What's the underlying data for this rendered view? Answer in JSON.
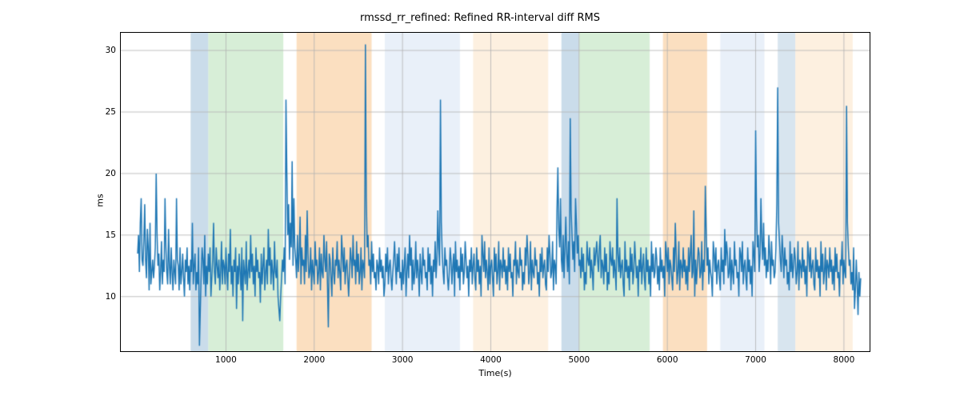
{
  "chart_data": {
    "type": "line",
    "title": "rmssd_rr_refined: Refined RR-interval diff RMS",
    "xlabel": "Time(s)",
    "ylabel": "ms",
    "xlim": [
      -200,
      8300
    ],
    "ylim": [
      5.5,
      31.5
    ],
    "xticks": [
      1000,
      2000,
      3000,
      4000,
      5000,
      6000,
      7000,
      8000
    ],
    "yticks": [
      10,
      15,
      20,
      25,
      30
    ],
    "grid": true,
    "line_color": "#1f77b4",
    "bands": [
      {
        "x0": 600,
        "x1": 800,
        "color": "#9ebfd8",
        "alpha": 0.55
      },
      {
        "x0": 800,
        "x1": 1650,
        "color": "#b6e0b6",
        "alpha": 0.55
      },
      {
        "x0": 1800,
        "x1": 2650,
        "color": "#f7c58c",
        "alpha": 0.55
      },
      {
        "x0": 2800,
        "x1": 3650,
        "color": "#d7e3f4",
        "alpha": 0.55
      },
      {
        "x0": 3800,
        "x1": 4650,
        "color": "#fbe3c7",
        "alpha": 0.55
      },
      {
        "x0": 4800,
        "x1": 5000,
        "color": "#9ebfd8",
        "alpha": 0.55
      },
      {
        "x0": 5000,
        "x1": 5800,
        "color": "#b6e0b6",
        "alpha": 0.55
      },
      {
        "x0": 5950,
        "x1": 6450,
        "color": "#f7c58c",
        "alpha": 0.55
      },
      {
        "x0": 6600,
        "x1": 7100,
        "color": "#d7e3f4",
        "alpha": 0.55
      },
      {
        "x0": 7250,
        "x1": 7450,
        "color": "#9ebfd8",
        "alpha": 0.4
      },
      {
        "x0": 7450,
        "x1": 8100,
        "color": "#fbe3c7",
        "alpha": 0.55
      }
    ],
    "series": [
      {
        "name": "rmssd_rr_refined",
        "x_start": 0,
        "x_step": 10,
        "values": [
          13.5,
          15.0,
          12.0,
          16.0,
          18.0,
          13.0,
          12.5,
          14.5,
          17.5,
          13.0,
          11.5,
          15.5,
          14.0,
          10.5,
          16.0,
          11.0,
          12.0,
          13.0,
          11.5,
          12.5,
          14.0,
          20.0,
          15.0,
          12.5,
          13.5,
          10.5,
          12.0,
          14.5,
          11.0,
          13.0,
          12.0,
          18.0,
          14.0,
          12.0,
          11.0,
          15.5,
          12.5,
          11.0,
          14.0,
          12.0,
          10.5,
          13.0,
          12.0,
          11.0,
          18.0,
          13.0,
          12.5,
          10.5,
          14.0,
          11.0,
          12.0,
          13.5,
          11.5,
          10.0,
          13.0,
          12.0,
          14.0,
          11.0,
          12.5,
          10.5,
          13.0,
          12.0,
          16.0,
          11.0,
          12.5,
          13.5,
          10.5,
          12.0,
          11.0,
          14.0,
          6.0,
          9.0,
          12.0,
          14.0,
          13.0,
          11.0,
          15.0,
          10.0,
          12.5,
          11.0,
          13.5,
          12.0,
          14.0,
          10.0,
          11.5,
          13.0,
          16.0,
          12.0,
          11.0,
          14.0,
          12.5,
          11.5,
          13.0,
          10.5,
          12.0,
          14.5,
          11.0,
          13.0,
          12.5,
          11.0,
          14.0,
          12.0,
          10.5,
          13.5,
          12.0,
          15.5,
          11.0,
          12.5,
          10.0,
          13.0,
          12.0,
          14.0,
          9.0,
          12.5,
          11.0,
          13.5,
          12.0,
          10.5,
          14.0,
          8.0,
          13.0,
          12.0,
          11.0,
          14.5,
          10.5,
          12.0,
          13.0,
          11.5,
          15.0,
          12.0,
          13.5,
          11.0,
          12.5,
          10.0,
          14.0,
          12.0,
          13.0,
          11.5,
          12.0,
          9.5,
          13.5,
          11.0,
          12.5,
          14.0,
          10.5,
          12.0,
          13.0,
          11.0,
          15.5,
          12.5,
          14.0,
          11.0,
          13.0,
          12.0,
          10.5,
          14.5,
          12.0,
          11.5,
          13.0,
          10.0,
          9.0,
          8.0,
          10.0,
          11.5,
          13.0,
          12.0,
          14.0,
          11.0,
          26.0,
          20.0,
          15.0,
          17.5,
          13.0,
          16.0,
          14.0,
          21.0,
          12.5,
          18.0,
          14.0,
          13.0,
          11.5,
          15.0,
          12.0,
          13.5,
          16.5,
          11.0,
          14.0,
          12.5,
          13.0,
          11.0,
          15.0,
          12.0,
          17.0,
          13.5,
          11.5,
          12.0,
          14.0,
          10.5,
          13.0,
          12.0,
          11.0,
          14.5,
          12.5,
          13.0,
          11.0,
          12.0,
          14.0,
          10.5,
          13.5,
          12.0,
          11.5,
          15.0,
          13.0,
          12.0,
          14.5,
          11.0,
          7.5,
          13.5,
          13.0,
          11.5,
          10.0,
          14.0,
          12.0,
          11.0,
          13.0,
          12.5,
          14.5,
          11.5,
          13.0,
          12.0,
          10.5,
          15.0,
          13.5,
          12.0,
          14.0,
          11.0,
          12.5,
          13.0,
          11.5,
          10.0,
          12.0,
          14.0,
          13.0,
          11.5,
          15.0,
          12.5,
          13.0,
          11.0,
          14.5,
          12.0,
          13.5,
          11.0,
          12.0,
          14.0,
          10.5,
          13.0,
          12.5,
          11.5,
          30.5,
          18.0,
          14.0,
          15.0,
          12.5,
          13.0,
          11.0,
          14.5,
          12.0,
          13.5,
          11.5,
          12.0,
          10.5,
          13.0,
          12.5,
          11.0,
          14.0,
          12.0,
          13.0,
          11.5,
          12.5,
          10.0,
          11.0,
          13.5,
          12.0,
          14.0,
          11.0,
          12.5,
          13.0,
          11.5,
          10.5,
          12.0,
          13.0,
          14.5,
          12.5,
          11.0,
          13.5,
          12.0,
          14.0,
          11.5,
          12.0,
          10.5,
          13.0,
          11.0,
          12.5,
          14.0,
          10.0,
          12.0,
          13.5,
          11.5,
          15.0,
          12.5,
          14.0,
          10.5,
          13.0,
          11.0,
          12.0,
          14.5,
          11.5,
          13.0,
          12.0,
          10.0,
          13.5,
          12.0,
          11.0,
          14.0,
          12.5,
          13.0,
          11.5,
          12.0,
          10.5,
          14.0,
          12.0,
          13.5,
          11.0,
          12.5,
          10.0,
          13.0,
          12.0,
          14.5,
          11.5,
          13.0,
          17.0,
          14.0,
          12.5,
          26.0,
          16.0,
          13.5,
          12.0,
          11.0,
          14.0,
          12.5,
          13.0,
          11.5,
          10.5,
          12.0,
          14.0,
          13.0,
          11.0,
          12.5,
          13.5,
          10.0,
          14.5,
          12.0,
          13.0,
          11.5,
          12.5,
          10.5,
          14.0,
          12.0,
          13.5,
          11.0,
          12.0,
          14.5,
          13.0,
          11.5,
          12.5,
          10.0,
          13.0,
          12.0,
          14.0,
          11.0,
          12.5,
          13.5,
          11.5,
          10.5,
          14.0,
          12.0,
          13.0,
          11.0,
          12.5,
          10.0,
          15.0,
          13.5,
          12.0,
          14.5,
          11.5,
          13.0,
          12.0,
          10.5,
          14.0,
          11.0,
          12.5,
          13.0,
          11.5,
          10.0,
          14.0,
          12.0,
          13.5,
          11.0,
          12.0,
          14.5,
          10.5,
          13.0,
          12.5,
          11.5,
          14.0,
          12.0,
          13.0,
          11.0,
          12.5,
          10.5,
          14.0,
          12.0,
          13.5,
          11.5,
          12.0,
          10.0,
          13.0,
          12.5,
          14.5,
          11.0,
          13.0,
          12.0,
          11.5,
          14.0,
          12.5,
          13.0,
          10.5,
          12.0,
          11.0,
          14.0,
          12.5,
          15.0,
          13.5,
          11.0,
          12.0,
          14.5,
          10.5,
          13.0,
          12.0,
          11.5,
          14.0,
          12.5,
          13.0,
          11.0,
          12.0,
          10.0,
          13.5,
          12.0,
          14.0,
          11.5,
          12.5,
          13.0,
          11.0,
          10.5,
          14.0,
          12.0,
          15.0,
          13.5,
          11.5,
          12.0,
          14.5,
          10.5,
          13.0,
          12.5,
          11.0,
          17.0,
          20.5,
          15.5,
          14.0,
          18.0,
          13.0,
          12.0,
          15.0,
          11.5,
          14.0,
          16.5,
          13.5,
          12.0,
          14.5,
          11.0,
          24.5,
          17.0,
          15.0,
          13.0,
          14.5,
          12.0,
          18.0,
          16.0,
          13.5,
          15.0,
          12.5,
          13.0,
          11.5,
          14.0,
          12.0,
          13.5,
          10.5,
          12.0,
          11.0,
          14.5,
          13.0,
          12.5,
          14.0,
          11.5,
          13.0,
          12.0,
          10.5,
          14.0,
          12.5,
          13.5,
          14.5,
          13.0,
          12.0,
          14.0,
          15.0,
          11.5,
          13.0,
          12.5,
          11.0,
          14.0,
          12.0,
          13.5,
          10.5,
          12.0,
          11.0,
          14.5,
          13.0,
          12.5,
          14.0,
          11.5,
          13.0,
          12.0,
          10.5,
          18.0,
          13.5,
          12.0,
          14.0,
          11.5,
          12.5,
          13.0,
          11.0,
          10.0,
          14.5,
          12.0,
          13.0,
          11.5,
          12.5,
          10.5,
          14.0,
          12.0,
          13.5,
          11.0,
          12.0,
          14.5,
          13.0,
          11.5,
          12.5,
          10.0,
          13.0,
          12.0,
          14.0,
          11.0,
          12.5,
          13.5,
          11.5,
          10.5,
          14.0,
          12.0,
          13.0,
          11.0,
          12.5,
          10.0,
          14.5,
          12.0,
          13.5,
          11.5,
          12.0,
          14.0,
          13.0,
          11.0,
          12.5,
          10.5,
          14.0,
          12.0,
          13.0,
          11.5,
          12.5,
          10.0,
          14.5,
          13.5,
          12.0,
          14.0,
          11.0,
          13.0,
          12.5,
          11.5,
          10.5,
          14.0,
          12.0,
          16.0,
          13.5,
          11.0,
          12.0,
          14.5,
          10.5,
          13.0,
          12.5,
          11.5,
          14.0,
          12.0,
          13.0,
          11.0,
          12.5,
          10.5,
          14.0,
          12.0,
          13.5,
          15.0,
          11.5,
          12.0,
          17.0,
          10.0,
          13.0,
          11.0,
          12.5,
          14.0,
          13.5,
          11.5,
          12.0,
          14.5,
          10.5,
          13.0,
          12.0,
          19.0,
          15.5,
          12.5,
          14.0,
          11.0,
          13.0,
          12.0,
          11.5,
          10.0,
          14.5,
          13.5,
          12.0,
          14.0,
          11.0,
          12.5,
          13.0,
          11.5,
          10.5,
          14.0,
          12.0,
          13.0,
          11.0,
          15.5,
          12.5,
          14.5,
          13.5,
          11.5,
          12.0,
          14.0,
          10.5,
          13.0,
          12.0,
          11.0,
          14.5,
          12.5,
          13.0,
          11.5,
          12.0,
          10.0,
          14.0,
          13.5,
          12.0,
          14.5,
          11.0,
          12.5,
          13.0,
          11.5,
          10.5,
          14.0,
          12.0,
          13.0,
          11.0,
          12.5,
          10.0,
          14.5,
          13.5,
          12.0,
          23.5,
          17.0,
          14.0,
          15.0,
          12.0,
          13.5,
          18.0,
          14.5,
          13.0,
          16.0,
          12.5,
          14.0,
          11.5,
          13.0,
          12.0,
          15.0,
          13.5,
          11.0,
          14.5,
          12.5,
          13.0,
          11.5,
          12.0,
          14.0,
          17.5,
          27.0,
          16.0,
          14.5,
          13.0,
          12.0,
          15.0,
          13.5,
          11.5,
          14.0,
          12.5,
          13.0,
          11.0,
          12.0,
          10.5,
          14.5,
          12.0,
          13.5,
          11.5,
          12.5,
          14.0,
          13.0,
          11.0,
          12.0,
          14.5,
          10.5,
          13.0,
          12.5,
          11.5,
          14.0,
          12.0,
          13.0,
          11.0,
          12.5,
          10.0,
          14.5,
          13.5,
          12.0,
          14.0,
          11.5,
          12.5,
          13.0,
          11.0,
          10.5,
          14.0,
          12.0,
          13.0,
          11.5,
          12.5,
          10.0,
          14.5,
          12.0,
          13.5,
          11.0,
          12.0,
          14.0,
          10.5,
          13.0,
          12.5,
          11.5,
          14.0,
          12.0,
          13.0,
          11.0,
          12.5,
          10.5,
          14.0,
          12.0,
          13.5,
          11.5,
          12.0,
          10.0,
          13.0,
          12.5,
          14.5,
          11.0,
          13.0,
          12.0,
          11.5,
          25.5,
          16.0,
          14.0,
          12.5,
          13.0,
          11.0,
          12.0,
          10.5,
          14.0,
          9.0,
          10.5,
          13.0,
          11.0,
          8.5,
          12.0,
          10.0,
          11.5
        ]
      }
    ]
  }
}
